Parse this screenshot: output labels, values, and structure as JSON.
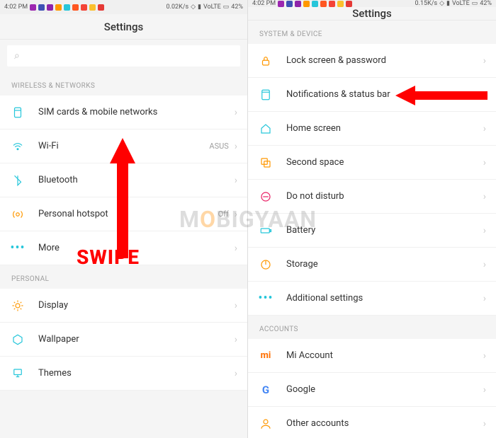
{
  "watermark": "MOBIGYAAN",
  "swipe_text": "SWIPE",
  "left": {
    "status": {
      "time": "4:02 PM",
      "net": "0.02K/s",
      "volte": "VoLTE",
      "battery": "42%"
    },
    "title": "Settings",
    "search_placeholder": "",
    "sections": {
      "wireless": {
        "header": "WIRELESS & NETWORKS",
        "items": [
          {
            "label": "SIM cards & mobile networks",
            "value": ""
          },
          {
            "label": "Wi-Fi",
            "value": "ASUS"
          },
          {
            "label": "Bluetooth",
            "value": ""
          },
          {
            "label": "Personal hotspot",
            "value": "Off"
          },
          {
            "label": "More",
            "value": ""
          }
        ]
      },
      "personal": {
        "header": "PERSONAL",
        "items": [
          {
            "label": "Display",
            "value": ""
          },
          {
            "label": "Wallpaper",
            "value": ""
          },
          {
            "label": "Themes",
            "value": ""
          }
        ]
      }
    }
  },
  "right": {
    "status": {
      "time": "4:02 PM",
      "net": "0.15K/s",
      "volte": "VoLTE",
      "battery": "42%"
    },
    "title": "Settings",
    "sections": {
      "system": {
        "header": "SYSTEM & DEVICE",
        "items": [
          {
            "label": "Lock screen & password"
          },
          {
            "label": "Notifications & status bar"
          },
          {
            "label": "Home screen"
          },
          {
            "label": "Second space"
          },
          {
            "label": "Do not disturb"
          },
          {
            "label": "Battery"
          },
          {
            "label": "Storage"
          },
          {
            "label": "Additional settings"
          }
        ]
      },
      "accounts": {
        "header": "ACCOUNTS",
        "items": [
          {
            "label": "Mi Account"
          },
          {
            "label": "Google"
          },
          {
            "label": "Other accounts"
          }
        ]
      }
    }
  }
}
